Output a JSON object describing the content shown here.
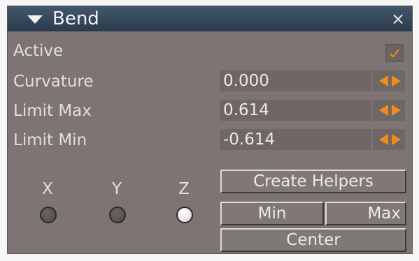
{
  "header": {
    "title": "Bend",
    "close_symbol": "×"
  },
  "rows": [
    {
      "label": "Active",
      "checked": true
    },
    {
      "label": "Curvature",
      "value": "0.000"
    },
    {
      "label": "Limit Max",
      "value": "0.614"
    },
    {
      "label": "Limit Min",
      "value": "-0.614"
    }
  ],
  "axes": [
    {
      "label": "X",
      "selected": false
    },
    {
      "label": "Y",
      "selected": false
    },
    {
      "label": "Z",
      "selected": true
    }
  ],
  "buttons": {
    "create_helpers": "Create Helpers",
    "min": "Min",
    "max": "Max",
    "center": "Center"
  },
  "colors": {
    "accent": "#f08c1c",
    "panel_bg": "#7d7573",
    "titlebar": "#34465a"
  }
}
